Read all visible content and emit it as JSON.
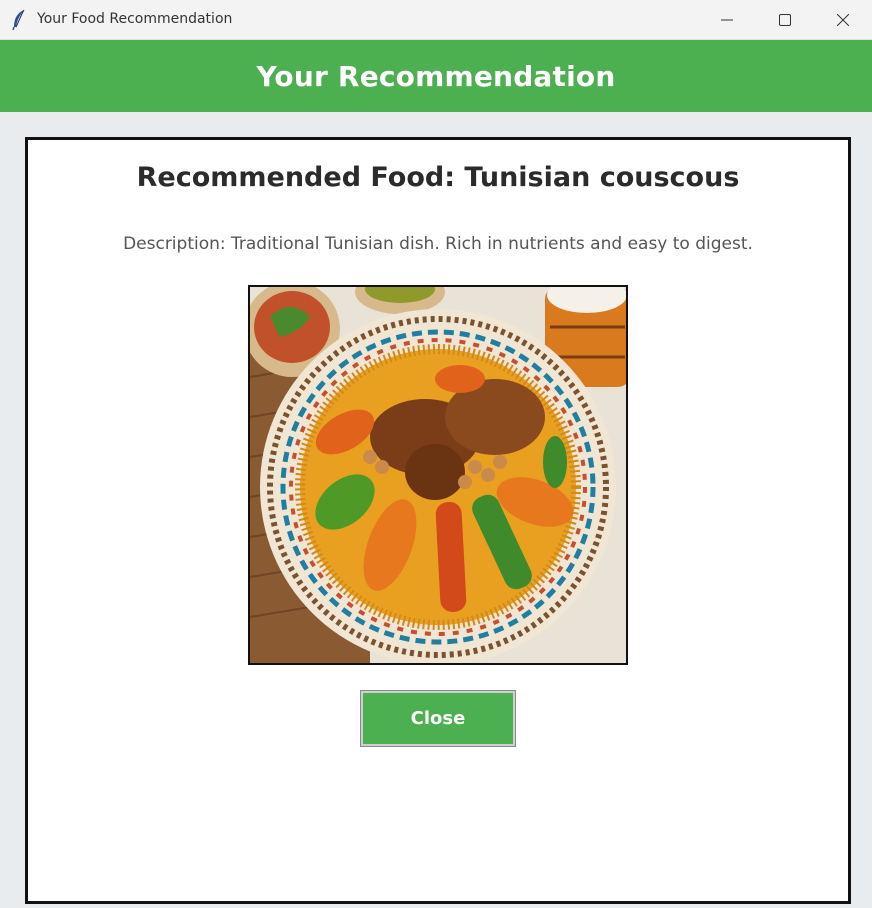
{
  "window": {
    "title": "Your Food Recommendation",
    "app_icon": "feather-icon",
    "controls": [
      "minimize-icon",
      "maximize-icon",
      "close-icon"
    ]
  },
  "header": {
    "title": "Your Recommendation",
    "color": "#4caf50"
  },
  "recommendation": {
    "title": "Recommended Food: Tunisian couscous",
    "description": "Description: Traditional Tunisian dish. Rich in nutrients and easy to digest.",
    "image_label": "Tunisian couscous"
  },
  "actions": {
    "close_label": "Close"
  }
}
